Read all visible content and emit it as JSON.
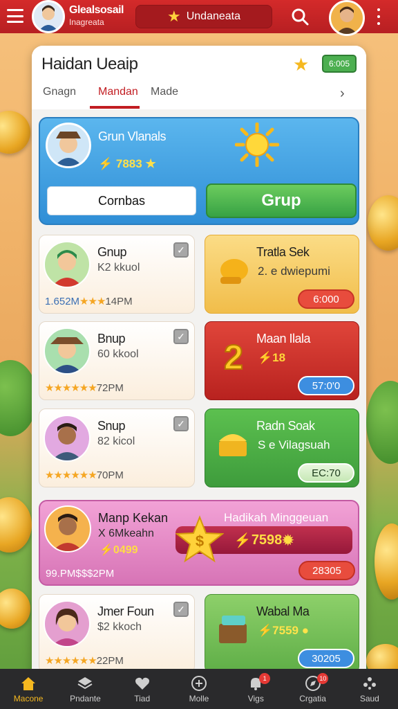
{
  "topbar": {
    "brand_line1": "Glealsosail",
    "brand_line2": "Inagreata",
    "center_label": "Undaneata",
    "center_icon": "star-icon",
    "colors": {
      "bar": "#c8252a",
      "pill": "#a41a1e"
    }
  },
  "panel": {
    "title": "Haidan Ueaip",
    "badge": "6:005",
    "tabs": [
      {
        "label": "Gnagn",
        "active": false
      },
      {
        "label": "Mandan",
        "active": true
      },
      {
        "label": "Made",
        "active": false
      }
    ]
  },
  "hero": {
    "name": "Grun Vlanals",
    "points": "7883",
    "button_secondary": "Cornbas",
    "button_primary": "Grup"
  },
  "left_cards": [
    {
      "name": "Gnup",
      "sub": "K2 kkuol",
      "footer_value": "1.652M",
      "stars": "★★★",
      "time": "14PM"
    },
    {
      "name": "Bnup",
      "sub": "60 kkool",
      "footer_value": "",
      "stars": "★★★★★★",
      "time": "72PM"
    },
    {
      "name": "Snup",
      "sub": "82 kicol",
      "footer_value": "",
      "stars": "★★★★★★",
      "time": "70PM"
    },
    {
      "name": "Jmer Foun",
      "sub": "$2 kkoch",
      "footer_value": "",
      "stars": "★★★★★★",
      "time": "22PM"
    }
  ],
  "right_cards": [
    {
      "title": "Tratla Sek",
      "sub": "2. e dwiepumi",
      "button": "6:000",
      "bg": "#f7cf6a",
      "btn": "#e84c3d"
    },
    {
      "title": "Maan Ilala",
      "sub": "18",
      "button": "57:0'0",
      "bg": "#d2362f",
      "btn": "#3d8ee0"
    },
    {
      "title": "Radn Soak",
      "sub": "S e Vilagsuah",
      "button": "EC:70",
      "bg": "#4cb04a",
      "btn": "#5cc452"
    },
    {
      "title": "Wabal Ma",
      "sub": "7559",
      "button": "30205",
      "bg": "#7cc45a",
      "btn": "#3d8ee0"
    }
  ],
  "wide_card": {
    "name": "Manp Kekan",
    "sub": "X 6Mkeahn",
    "points": "0499",
    "footer": "99.PM$$$2PM",
    "title": "Hadikah Minggeuan",
    "bar_value": "7598",
    "button": "28305"
  },
  "nav": [
    {
      "label": "Macone",
      "icon": "home-icon",
      "active": true,
      "badge": ""
    },
    {
      "label": "Pndante",
      "icon": "layers-icon",
      "active": false,
      "badge": ""
    },
    {
      "label": "Tiad",
      "icon": "heart-icon",
      "active": false,
      "badge": ""
    },
    {
      "label": "Molle",
      "icon": "plus-circle-icon",
      "active": false,
      "badge": ""
    },
    {
      "label": "Vigs",
      "icon": "bell-icon",
      "active": false,
      "badge": "1"
    },
    {
      "label": "Crgatia",
      "icon": "compass-icon",
      "active": false,
      "badge": "10"
    },
    {
      "label": "Saud",
      "icon": "dots-grid-icon",
      "active": false,
      "badge": ""
    }
  ]
}
